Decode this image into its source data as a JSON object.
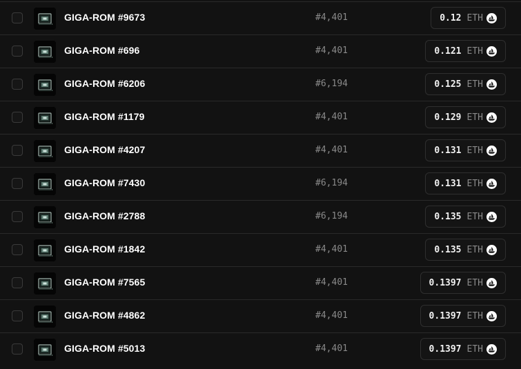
{
  "currency_unit": "ETH",
  "thumbnail_icon": "giga-rom-thumbnail",
  "marketplace_icon": "opensea-icon",
  "rows": [
    {
      "name": "GIGA-ROM #9673",
      "rank": "#4,401",
      "price": "0.12"
    },
    {
      "name": "GIGA-ROM #696",
      "rank": "#4,401",
      "price": "0.121"
    },
    {
      "name": "GIGA-ROM #6206",
      "rank": "#6,194",
      "price": "0.125"
    },
    {
      "name": "GIGA-ROM #1179",
      "rank": "#4,401",
      "price": "0.129"
    },
    {
      "name": "GIGA-ROM #4207",
      "rank": "#4,401",
      "price": "0.131"
    },
    {
      "name": "GIGA-ROM #7430",
      "rank": "#6,194",
      "price": "0.131"
    },
    {
      "name": "GIGA-ROM #2788",
      "rank": "#6,194",
      "price": "0.135"
    },
    {
      "name": "GIGA-ROM #1842",
      "rank": "#4,401",
      "price": "0.135"
    },
    {
      "name": "GIGA-ROM #7565",
      "rank": "#4,401",
      "price": "0.1397"
    },
    {
      "name": "GIGA-ROM #4862",
      "rank": "#4,401",
      "price": "0.1397"
    },
    {
      "name": "GIGA-ROM #5013",
      "rank": "#4,401",
      "price": "0.1397"
    }
  ]
}
